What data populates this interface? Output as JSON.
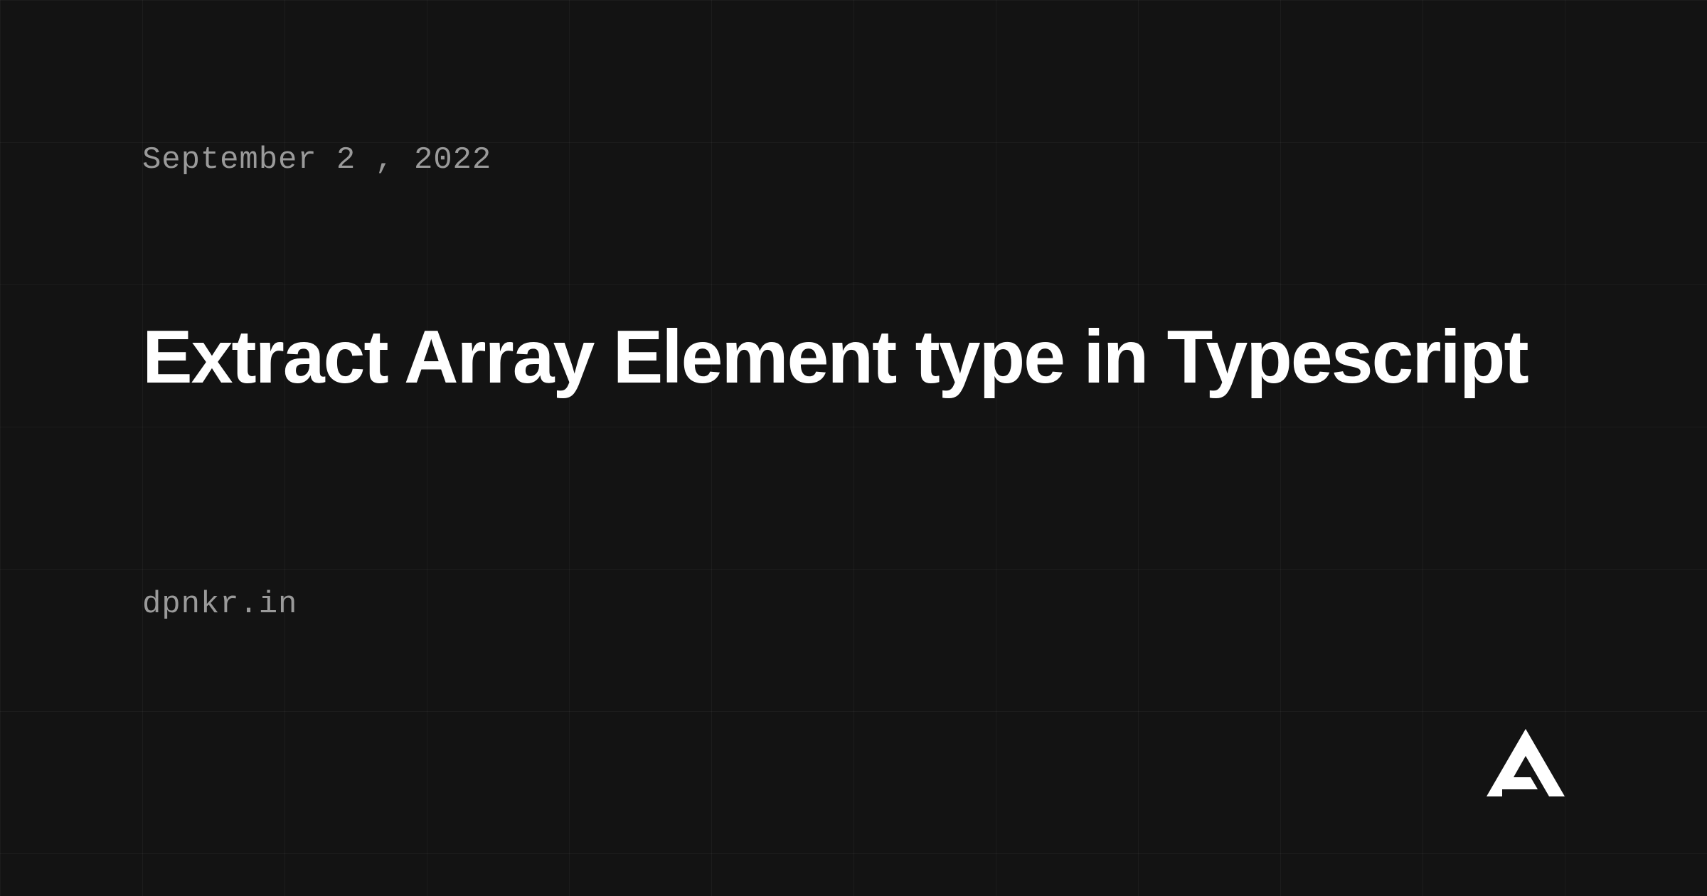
{
  "date": "September 2 , 2022",
  "title": "Extract Array Element type in Typescript",
  "siteUrl": "dpnkr.in"
}
